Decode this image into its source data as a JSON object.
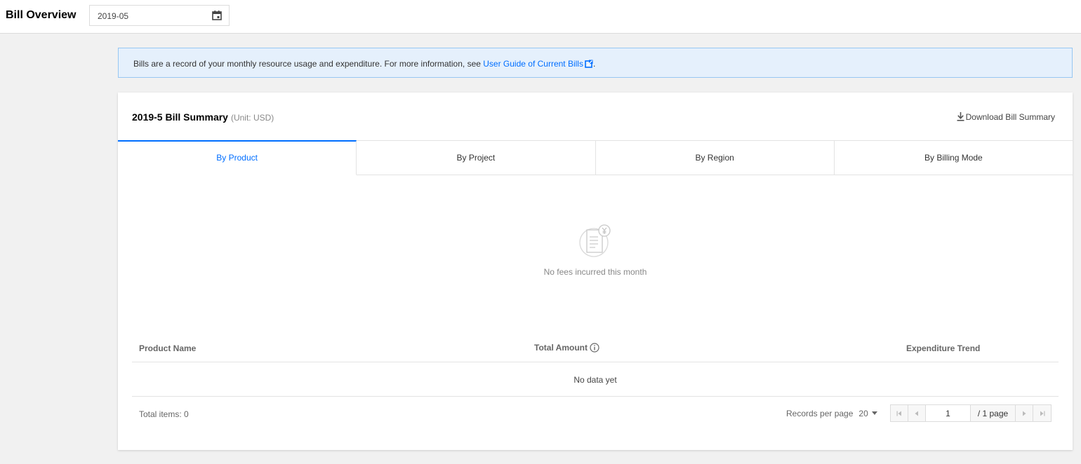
{
  "header": {
    "title": "Bill Overview",
    "month_value": "2019-05",
    "calendar_icon": "calendar-icon"
  },
  "notice": {
    "text": "Bills are a record of your monthly resource usage and expenditure. For more information, see ",
    "link_text": "User Guide of Current Bills",
    "suffix": ".",
    "link_icon": "external-link-icon"
  },
  "summary": {
    "title": "2019-5 Bill Summary",
    "unit": "(Unit: USD)",
    "download_label": "Download Bill Summary",
    "download_icon": "download-icon"
  },
  "tabs": [
    {
      "label": "By Product",
      "active": true
    },
    {
      "label": "By Project",
      "active": false
    },
    {
      "label": "By Region",
      "active": false
    },
    {
      "label": "By Billing Mode",
      "active": false
    }
  ],
  "empty_state": {
    "icon": "empty-bill-icon",
    "text": "No fees incurred this month"
  },
  "table": {
    "columns": [
      "Product Name",
      "Total Amount",
      "Expenditure Trend"
    ],
    "empty_text": "No data yet"
  },
  "footer": {
    "total_label": "Total items:",
    "total_count": "0",
    "records_per_page_label": "Records per page",
    "records_per_page_value": "20",
    "current_page": "1",
    "page_total": "/ 1 page"
  },
  "colors": {
    "accent": "#006eff",
    "notice_bg": "#e5f0fc",
    "notice_border": "#97c7f2",
    "page_bg": "#f1f1f1"
  }
}
